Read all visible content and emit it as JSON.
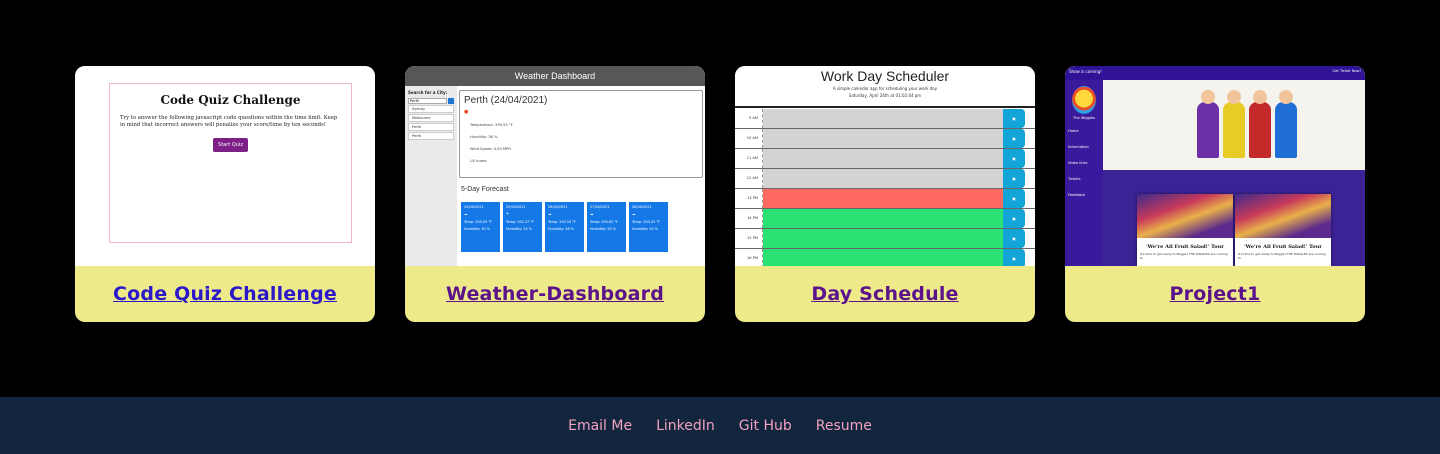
{
  "projects": [
    {
      "label": "Code Quiz Challenge",
      "thumb": {
        "title": "Code Quiz Challenge",
        "text": "Try to answer the following javascript code questions within the time limit. Keep in mind that incorrect answers will penalize your score/time by ten seconds!",
        "button": "Start Quiz"
      }
    },
    {
      "label": "Weather-Dashboard",
      "thumb": {
        "header": "Weather Dashboard",
        "search_label": "Search for a City:",
        "search_value": "Perth",
        "cities": [
          "Sydney",
          "Melbourne",
          "Perth",
          "Perth"
        ],
        "current_title": "Perth (24/04/2021)",
        "lines": [
          "Temperature: 290.53 °F",
          "Humidity: 38 %",
          "Wind Speed: 4.63 MPH",
          "UV Index:"
        ],
        "forecast_title": "5-Day Forecast",
        "forecast": [
          {
            "date": "24/04/2021",
            "temp": "Temp: 290.59 °F",
            "humidity": "Humidity: 30 %"
          },
          {
            "date": "25/04/2021",
            "temp": "Temp: 292.37 °F",
            "humidity": "Humidity: 54 %"
          },
          {
            "date": "26/04/2021",
            "temp": "Temp: 292.54 °F",
            "humidity": "Humidity: 46 %"
          },
          {
            "date": "27/04/2021",
            "temp": "Temp: 290.62 °F",
            "humidity": "Humidity: 50 %"
          },
          {
            "date": "28/04/2021",
            "temp": "Temp: 290.43 °F",
            "humidity": "Humidity: 50 %"
          }
        ]
      }
    },
    {
      "label": "Day Schedule",
      "thumb": {
        "title": "Work Day Scheduler",
        "subtitle": "A simple calendar app for scheduling your work day",
        "date": "Saturday, April 24th at 01:02:44 pm",
        "rows": [
          {
            "hour": "9 AM",
            "state": "past"
          },
          {
            "hour": "10 AM",
            "state": "past"
          },
          {
            "hour": "11 AM",
            "state": "past"
          },
          {
            "hour": "12 AM",
            "state": "past"
          },
          {
            "hour": "13 PM",
            "state": "present"
          },
          {
            "hour": "14 PM",
            "state": "future"
          },
          {
            "hour": "15 PM",
            "state": "future"
          },
          {
            "hour": "16 PM",
            "state": "future"
          }
        ]
      }
    },
    {
      "label": "Project1",
      "thumb": {
        "banner": "Show is coming!",
        "cta": "Get Ticket Now!",
        "brand": "The Wiggles",
        "nav": [
          "Home",
          "Information",
          "Video links",
          "Tickets",
          "Feedback"
        ],
        "card_title": "'We're All Fruit Salad!' Tour",
        "card_text": "It's time to get ready to Wiggle! THE WIGGLES are coming to"
      }
    }
  ],
  "footer": {
    "links": [
      "Email Me",
      "LinkedIn",
      "Git Hub",
      "Resume"
    ]
  },
  "colors": {
    "page_bg": "#000000",
    "caption_bg": "#eeea8a",
    "footer_bg": "#11263d",
    "footer_link": "#f2a1c0",
    "link_visited": "#5c128a",
    "link_unvisited": "#2a18c9"
  }
}
